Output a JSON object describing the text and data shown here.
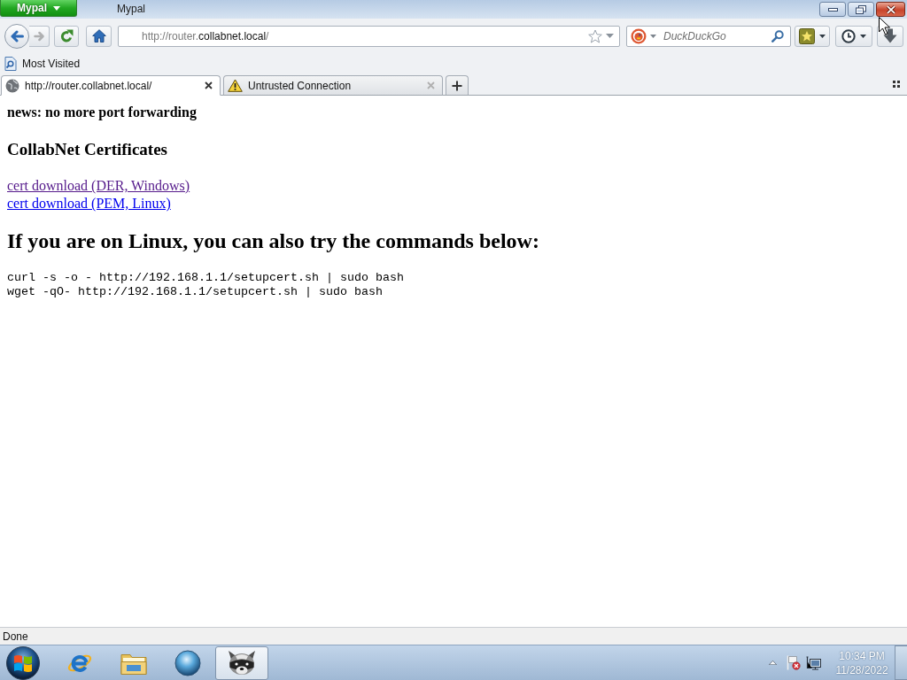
{
  "window": {
    "app_button": "Mypal",
    "title": "Mypal"
  },
  "toolbar": {
    "nav_buttons": [
      {
        "kind": "back",
        "disabled": false
      },
      {
        "kind": "forward",
        "disabled": true
      },
      {
        "kind": "reload",
        "disabled": false
      },
      {
        "kind": "home",
        "disabled": false
      }
    ],
    "address": [
      {
        "text": "http://router.",
        "host": false
      },
      {
        "text": "collabnet.local",
        "host": true
      },
      {
        "text": "/",
        "host": false
      }
    ],
    "search": {
      "placeholder": "DuckDuckGo"
    }
  },
  "bookmarks_bar": {
    "items": [
      {
        "label": "Most Visited"
      }
    ]
  },
  "tabs": [
    {
      "label": "http://router.collabnet.local/",
      "kind": "page",
      "selected": true
    },
    {
      "label": "Untrusted Connection",
      "kind": "warning",
      "selected": false
    }
  ],
  "page": {
    "news": "news: no more port forwarding",
    "heading": "CollabNet Certificates",
    "links": [
      {
        "label": "cert download (DER, Windows)",
        "visited": true
      },
      {
        "label": "cert download (PEM, Linux)",
        "visited": false
      }
    ],
    "subheading": "If you are on Linux, you can also try the commands below:",
    "commands": [
      "curl -s -o - http://192.168.1.1/setupcert.sh | sudo bash",
      "wget -qO- http://192.168.1.1/setupcert.sh | sudo bash"
    ]
  },
  "status_bar": {
    "text": "Done"
  },
  "taskbar": {
    "apps": [
      {
        "kind": "web",
        "selected": false
      },
      {
        "kind": "files",
        "selected": false
      },
      {
        "kind": "media",
        "selected": false
      },
      {
        "kind": "browser",
        "selected": true
      }
    ],
    "clock": {
      "time": "10:34 PM",
      "date": "11/28/2022"
    }
  }
}
